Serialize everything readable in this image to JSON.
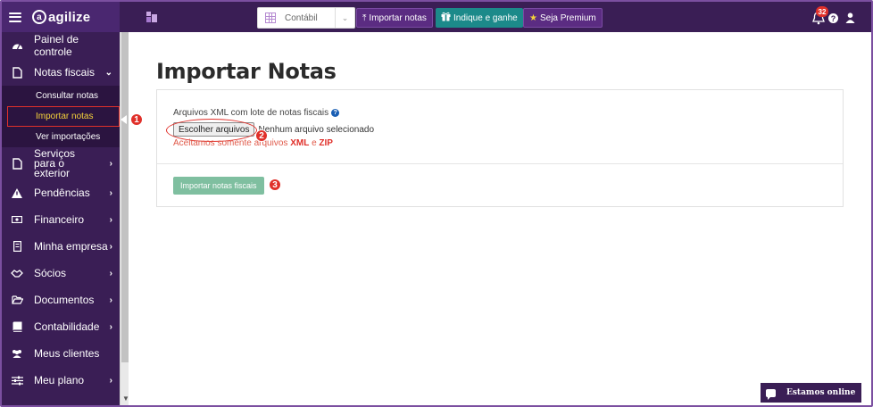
{
  "brand": {
    "name": "agilize"
  },
  "sidebar": {
    "items": [
      {
        "label": "Painel de controle",
        "icon": "dashboard-icon"
      },
      {
        "label": "Notas fiscais",
        "icon": "file-icon",
        "chevron": "down"
      },
      {
        "label": "Serviços para o exterior",
        "icon": "file-icon",
        "chevron": "right"
      },
      {
        "label": "Pendências",
        "icon": "warning-icon",
        "chevron": "right"
      },
      {
        "label": "Financeiro",
        "icon": "money-icon",
        "chevron": "right"
      },
      {
        "label": "Minha empresa",
        "icon": "building-icon",
        "chevron": "right"
      },
      {
        "label": "Sócios",
        "icon": "handshake-icon",
        "chevron": "right"
      },
      {
        "label": "Documentos",
        "icon": "folder-open-icon",
        "chevron": "right"
      },
      {
        "label": "Contabilidade",
        "icon": "book-icon",
        "chevron": "right"
      },
      {
        "label": "Meus clientes",
        "icon": "users-icon"
      },
      {
        "label": "Meu plano",
        "icon": "sliders-icon",
        "chevron": "right"
      }
    ],
    "subitems": [
      {
        "label": "Consultar notas"
      },
      {
        "label": "Importar notas",
        "active": true
      },
      {
        "label": "Ver importações"
      }
    ]
  },
  "topbar": {
    "select_value": "Contábil",
    "import_button": "Importar notas",
    "indique_button": "Indique e ganhe",
    "premium_button": "Seja Premium",
    "notification_count": "32"
  },
  "page": {
    "title": "Importar Notas",
    "field_label": "Arquivos XML com lote de notas fiscais",
    "choose_files": "Escolher arquivos",
    "no_file": "Nenhum arquivo selecionado",
    "hint_prefix": "Aceitamos somente arquivos",
    "hint_xml": "XML",
    "hint_and": "e",
    "hint_zip": "ZIP",
    "submit": "Importar notas fiscais"
  },
  "annotations": {
    "step1": "1",
    "step2": "2",
    "step3": "3"
  },
  "chat": {
    "label": "Estamos online"
  },
  "colors": {
    "sidebar": "#3a1e55",
    "accent": "#5b2c82",
    "teal": "#1c8a8a",
    "success": "#7fbfa0",
    "alert": "#e0302a"
  }
}
